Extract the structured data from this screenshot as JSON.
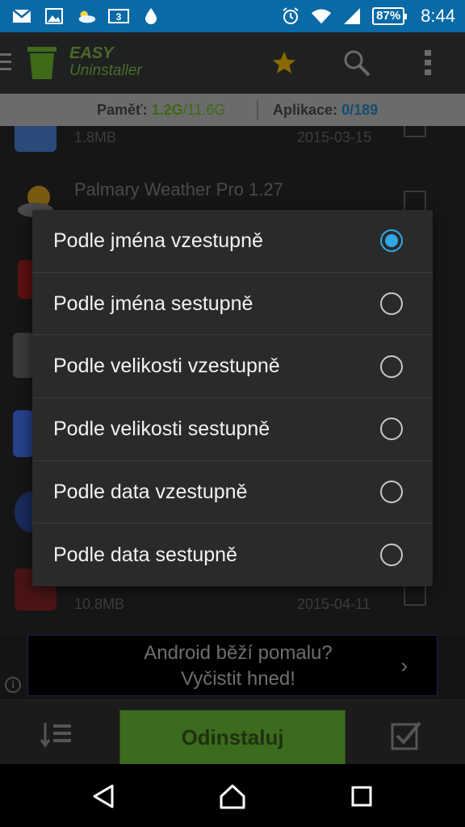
{
  "status_bar": {
    "time": "8:44",
    "battery": "87%",
    "icons": [
      "gmail-icon",
      "gallery-icon",
      "cloud-sun-icon",
      "3g-icon",
      "water-drop-icon",
      "alarm-icon",
      "wifi-icon",
      "signal-icon"
    ]
  },
  "app_bar": {
    "name_line1": "EASY",
    "name_line2": "Uninstaller",
    "icons": [
      "menu-icon",
      "star-icon",
      "search-icon",
      "overflow-icon"
    ]
  },
  "info_strip": {
    "memory_label": "Paměť:",
    "memory_used": "1.2G",
    "memory_total": "/11.6G",
    "apps_label": "Aplikace:",
    "apps_selected": "0",
    "apps_total": "/189"
  },
  "list_rows": [
    {
      "title": "",
      "size": "1.8MB",
      "date": "2015-03-15"
    },
    {
      "title": "Palmary Weather Pro 1.27",
      "size": "",
      "date": ""
    },
    {
      "title": "",
      "size": "10.8MB",
      "date": "2015-04-11"
    }
  ],
  "dialog": {
    "options": [
      {
        "label": "Podle jména vzestupně",
        "selected": true
      },
      {
        "label": "Podle jména sestupně",
        "selected": false
      },
      {
        "label": "Podle velikosti vzestupně",
        "selected": false
      },
      {
        "label": "Podle velikosti sestupně",
        "selected": false
      },
      {
        "label": "Podle data vzestupně",
        "selected": false
      },
      {
        "label": "Podle data sestupně",
        "selected": false
      }
    ]
  },
  "ad": {
    "line1": "Android běží pomalu?",
    "line2": "Vyčistit hned!",
    "info": "i",
    "chevron": "›"
  },
  "action_bar": {
    "uninstall_label": "Odinstaluj"
  },
  "colors": {
    "status_bar": "#0a6aa6",
    "accent_radio": "#2ea9e6",
    "uninstall_green": "#3b6b1e",
    "dialog_bg": "#2a2a2a"
  }
}
